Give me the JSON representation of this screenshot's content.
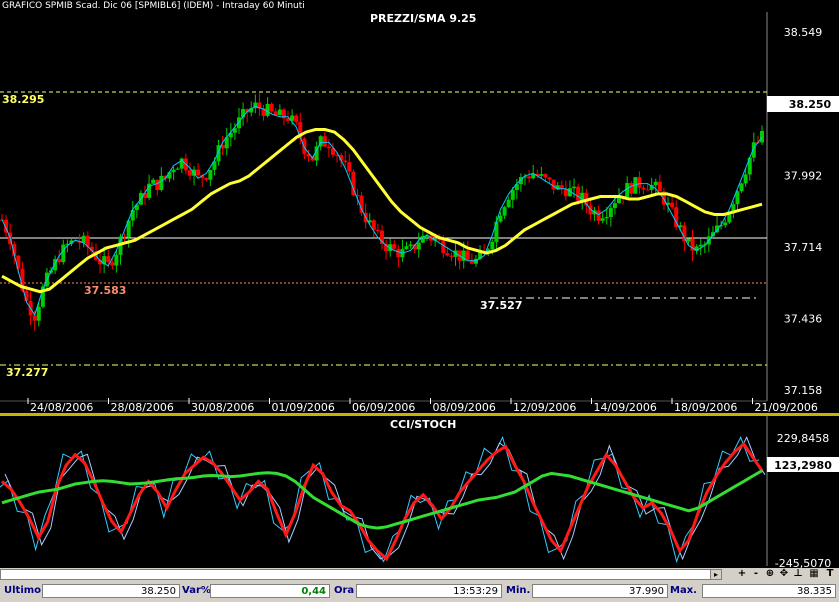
{
  "window_title": "GRAFICO SPMIB Scad. Dic 06 [SPMIBL6] (IDEM) - Intraday 60 Minuti",
  "price_panel": {
    "title": "PREZZI/SMA 9.25",
    "y_ticks": [
      "38.549",
      "38.250",
      "37.992",
      "37.714",
      "37.436",
      "37.158"
    ],
    "y_values": [
      38.549,
      38.271,
      37.992,
      37.714,
      37.436,
      37.158
    ],
    "last_price_label": "38.250",
    "level_labels": {
      "high": "38.295",
      "low1": "37.583",
      "low2": "37.527",
      "low3": "37.277"
    },
    "x_labels": [
      "24/08/2006",
      "28/08/2006",
      "30/08/2006",
      "01/09/2006",
      "06/09/2006",
      "08/09/2006",
      "12/09/2006",
      "14/09/2006",
      "18/09/2006",
      "21/09/2006"
    ],
    "colors": {
      "up": "#00cc00",
      "down": "#ff0000",
      "sma_fast": "#00ccff",
      "sma_slow": "#ffff33",
      "level_high": "#ffff66",
      "level_low": "#ff8c69",
      "axis_bg": "#ffffff"
    }
  },
  "osc_panel": {
    "title": "CCI/STOCH",
    "y_ticks": [
      "229,8458",
      "123,2980",
      "-245,5070"
    ],
    "colors": {
      "cci": "#ff1a1a",
      "stoch_k": "#33ccff",
      "stoch_d": "#aaccff",
      "smooth": "#33dd33"
    }
  },
  "toolbar": {
    "buttons": [
      "+",
      "-",
      "⊕",
      "✥",
      "⊥",
      "▦",
      "T"
    ]
  },
  "status": {
    "ultimo_label": "Ultimo",
    "ultimo_value": "38.250",
    "var_label": "Var%",
    "var_value": "0,44",
    "ora_label": "Ora",
    "ora_value": "13:53:29",
    "min_label": "Min.",
    "min_value": "37.990",
    "max_label": "Max.",
    "max_value": "38.335"
  },
  "chart_data": [
    {
      "type": "line",
      "title": "PREZZI/SMA 9.25",
      "x_categories": [
        "24/08/2006",
        "28/08/2006",
        "30/08/2006",
        "01/09/2006",
        "06/09/2006",
        "08/09/2006",
        "12/09/2006",
        "14/09/2006",
        "18/09/2006",
        "21/09/2006"
      ],
      "ylim": [
        37.158,
        38.549
      ],
      "series": [
        {
          "values": [
            37.82,
            37.75,
            37.62,
            37.5,
            37.45,
            37.55,
            37.62,
            37.68,
            37.72,
            37.74,
            37.73,
            37.7,
            37.66,
            37.64,
            37.7,
            37.78,
            37.86,
            37.9,
            37.95,
            37.96,
            37.98,
            38.03,
            38.05,
            38.02,
            37.98,
            38.0,
            38.05,
            38.12,
            38.16,
            38.2,
            38.24,
            38.26,
            38.25,
            38.23,
            38.22,
            38.22,
            38.18,
            38.1,
            38.06,
            38.12,
            38.12,
            38.08,
            38.02,
            37.94,
            37.86,
            37.8,
            37.75,
            37.72,
            37.7,
            37.69,
            37.7,
            37.74,
            37.76,
            37.74,
            37.72,
            37.7,
            37.68,
            37.66,
            37.66,
            37.68,
            37.76,
            37.86,
            37.92,
            37.96,
            37.99,
            38.0,
            37.98,
            37.96,
            37.94,
            37.94,
            37.92,
            37.9,
            37.86,
            37.84,
            37.86,
            37.9,
            37.93,
            37.95,
            37.96,
            37.96,
            37.94,
            37.9,
            37.84,
            37.78,
            37.72,
            37.7,
            37.72,
            37.76,
            37.8,
            37.86,
            37.94,
            38.02,
            38.1,
            38.14
          ]
        },
        {
          "values": [
            37.6,
            37.58,
            37.56,
            37.55,
            37.54,
            37.55,
            37.58,
            37.61,
            37.64,
            37.67,
            37.69,
            37.71,
            37.72,
            37.73,
            37.74,
            37.76,
            37.78,
            37.8,
            37.82,
            37.84,
            37.86,
            37.89,
            37.92,
            37.94,
            37.96,
            37.97,
            37.99,
            38.02,
            38.05,
            38.08,
            38.11,
            38.14,
            38.16,
            38.17,
            38.17,
            38.16,
            38.13,
            38.09,
            38.04,
            37.99,
            37.94,
            37.89,
            37.85,
            37.82,
            37.79,
            37.77,
            37.75,
            37.74,
            37.73,
            37.71,
            37.7,
            37.69,
            37.7,
            37.72,
            37.75,
            37.78,
            37.8,
            37.82,
            37.84,
            37.86,
            37.88,
            37.89,
            37.9,
            37.91,
            37.91,
            37.91,
            37.9,
            37.9,
            37.91,
            37.92,
            37.92,
            37.91,
            37.89,
            37.87,
            37.85,
            37.84,
            37.84,
            37.85,
            37.86,
            37.87,
            37.88
          ]
        },
        {
          "values": [
            37.277,
            38.295,
            37.583,
            37.527
          ]
        }
      ]
    },
    {
      "type": "line",
      "title": "CCI/STOCH",
      "ylim": [
        -245.507,
        229.8458
      ],
      "series": [
        {
          "values": [
            60,
            30,
            -20,
            -80,
            -150,
            -90,
            40,
            120,
            160,
            130,
            60,
            -20,
            -90,
            -130,
            -60,
            10,
            60,
            20,
            -40,
            30,
            90,
            120,
            150,
            130,
            90,
            40,
            -10,
            20,
            60,
            30,
            -60,
            -140,
            -60,
            40,
            120,
            90,
            20,
            -30,
            -50,
            -100,
            -160,
            -200,
            -230,
            -160,
            -80,
            -20,
            10,
            -30,
            -80,
            -40,
            20,
            60,
            100,
            140,
            170,
            190,
            120,
            60,
            -20,
            -90,
            -160,
            -200,
            -120,
            -40,
            40,
            100,
            160,
            120,
            60,
            0,
            -40,
            -20,
            -60,
            -120,
            -200,
            -160,
            -60,
            20,
            80,
            130,
            170,
            200,
            150,
            100
          ]
        },
        {
          "values": [
            -20,
            -10,
            0,
            10,
            20,
            25,
            30,
            40,
            50,
            55,
            60,
            62,
            60,
            55,
            50,
            52,
            55,
            60,
            65,
            70,
            72,
            75,
            80,
            82,
            80,
            78,
            80,
            85,
            90,
            92,
            90,
            80,
            60,
            30,
            0,
            -20,
            -40,
            -60,
            -80,
            -100,
            -110,
            -115,
            -110,
            -100,
            -90,
            -80,
            -70,
            -60,
            -50,
            -40,
            -30,
            -20,
            -10,
            -5,
            0,
            10,
            20,
            40,
            60,
            80,
            90,
            85,
            80,
            70,
            60,
            50,
            40,
            30,
            20,
            10,
            0,
            -10,
            -20,
            -30,
            -40,
            -50,
            -40,
            -20,
            0,
            20,
            40,
            60,
            80,
            100
          ]
        }
      ]
    }
  ]
}
